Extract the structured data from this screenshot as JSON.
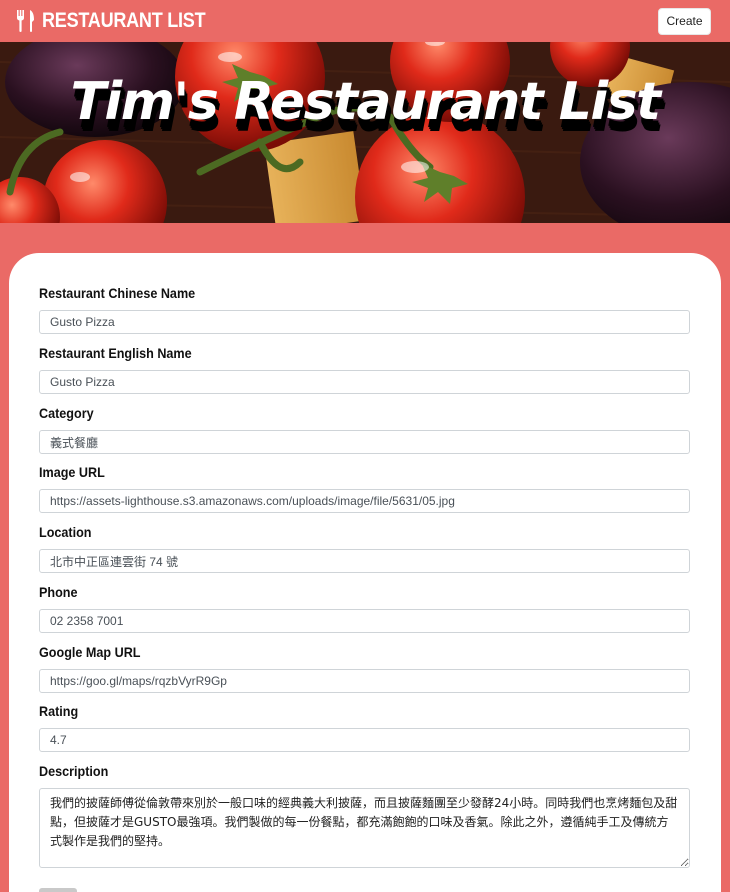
{
  "navbar": {
    "brand_text": "RESTAURANT LIST",
    "brand_icon": "utensils-icon",
    "create_label": "Create"
  },
  "banner": {
    "title": "Tim's Restaurant List"
  },
  "form": {
    "chinese_name": {
      "label": "Restaurant Chinese Name",
      "value": "Gusto Pizza"
    },
    "english_name": {
      "label": "Restaurant English Name",
      "value": "Gusto Pizza"
    },
    "category": {
      "label": "Category",
      "value": "義式餐廳"
    },
    "image_url": {
      "label": "Image URL",
      "value": "https://assets-lighthouse.s3.amazonaws.com/uploads/image/file/5631/05.jpg"
    },
    "location": {
      "label": "Location",
      "value": "北市中正區連雲街 74 號"
    },
    "phone": {
      "label": "Phone",
      "value": "02 2358 7001"
    },
    "google_map": {
      "label": "Google Map URL",
      "value": "https://goo.gl/maps/rqzbVyrR9Gp"
    },
    "rating": {
      "label": "Rating",
      "value": "4.7"
    },
    "description": {
      "label": "Description",
      "value": "我們的披薩師傅從倫敦帶來別於一般口味的經典義大利披薩，而且披薩麵團至少發酵24小時。同時我們也烹烤麵包及甜點，但披薩才是GUSTO最強項。我們製做的每一份餐點，都充滿飽飽的口味及香氣。除此之外，遵循純手工及傳統方式製作是我們的堅持。"
    }
  },
  "colors": {
    "brand": "#ea6a66",
    "card": "#ffffff"
  }
}
